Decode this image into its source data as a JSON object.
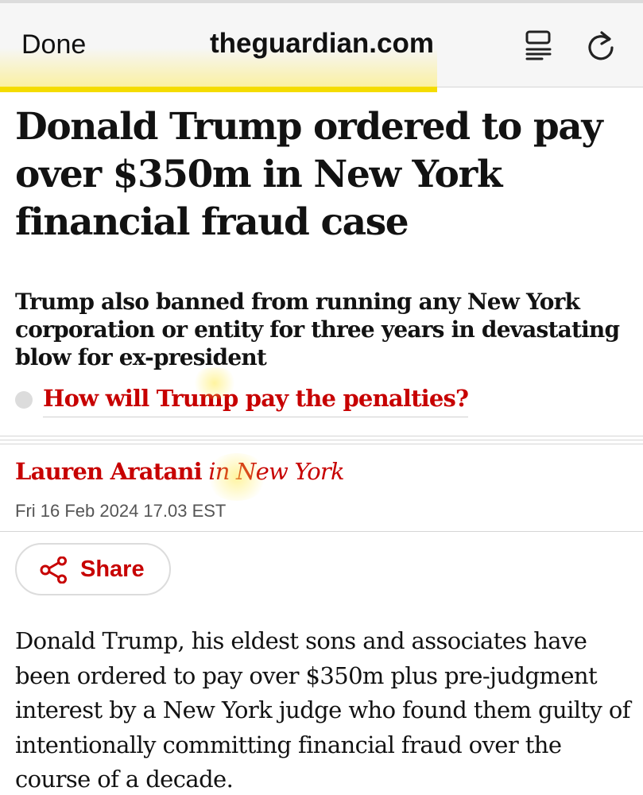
{
  "browser": {
    "done_label": "Done",
    "url": "theguardian.com",
    "load_progress": 0.68,
    "colors": {
      "progress": "#f4dc00",
      "bar_bg": "#f6f6f6"
    },
    "icons": {
      "reader": "reader-mode-icon",
      "reload": "reload-icon"
    }
  },
  "article": {
    "headline": "Donald Trump ordered to pay over $350m in New York financial fraud case",
    "standfirst": "Trump also banned from running any New York corporation or entity for three years in devastating blow for ex-president",
    "related_link": "How will Trump pay the penalties?",
    "byline_author": "Lauren Aratani",
    "byline_location": "in New York",
    "dateline": "Fri 16 Feb 2024 17.03 EST",
    "share_label": "Share",
    "body": "Donald Trump, his eldest sons and associates have been ordered to pay over $350m plus pre-judgment interest by a New York judge who found them guilty of intentionally committing financial fraud over the course of a decade.",
    "colors": {
      "accent": "#c70000",
      "text": "#121212"
    },
    "icons": {
      "share": "share-icon",
      "related": "bullet-dot-icon"
    }
  }
}
